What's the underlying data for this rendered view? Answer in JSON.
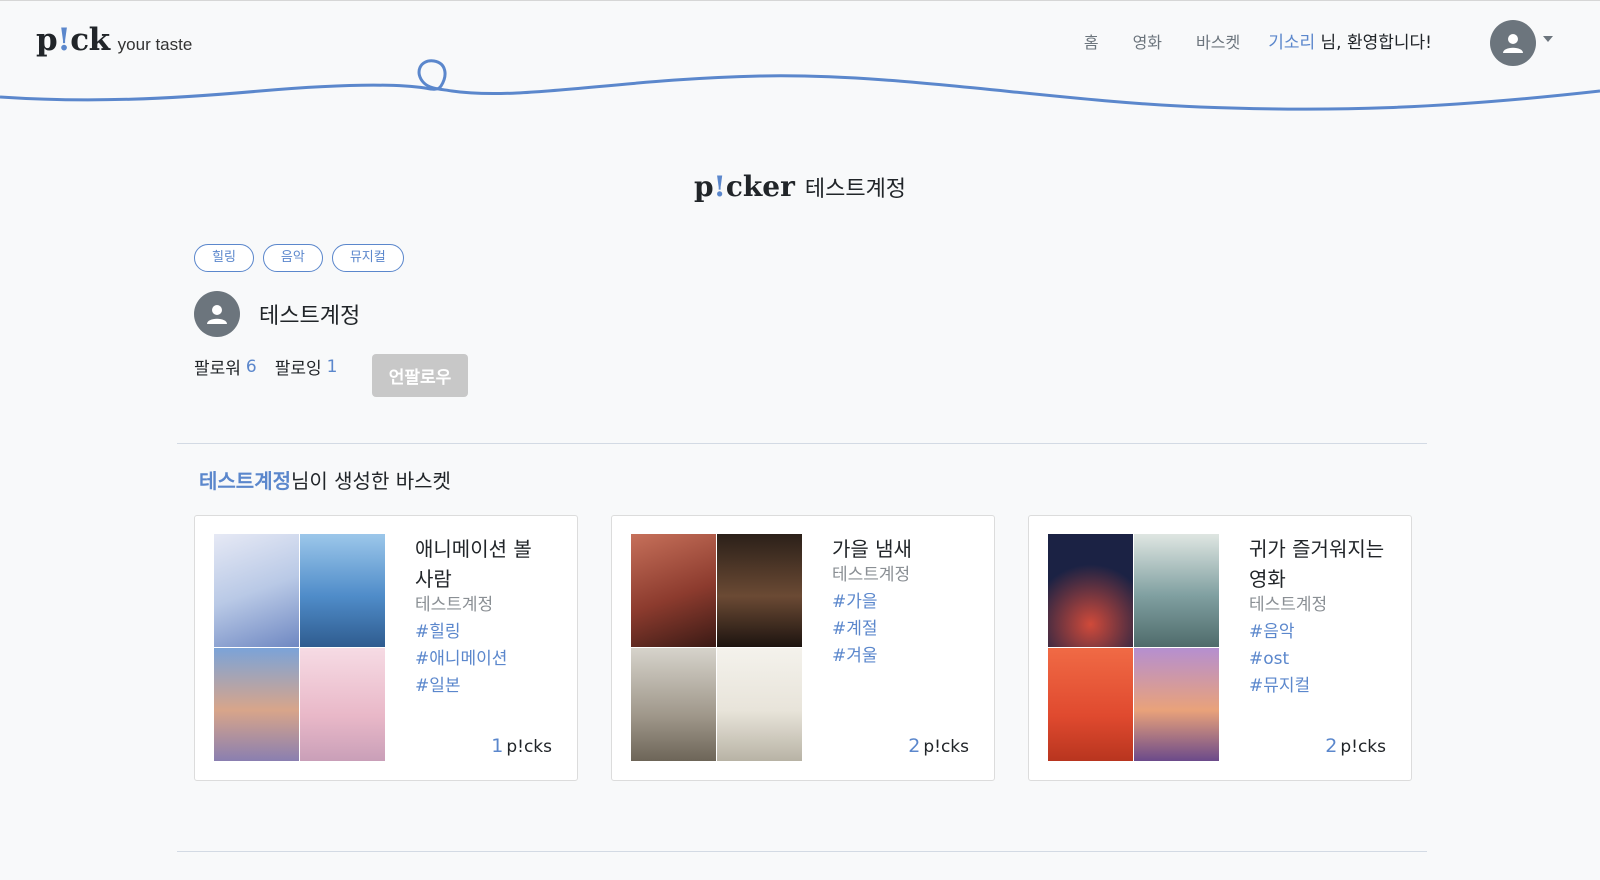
{
  "header": {
    "logo": {
      "p": "p",
      "bang": "!",
      "ck": "ck",
      "tagline": "your taste"
    },
    "nav": [
      {
        "label": "홈"
      },
      {
        "label": "영화"
      },
      {
        "label": "바스켓"
      }
    ],
    "welcome": {
      "username": "기소리",
      "suffix": " 님, 환영합니다!"
    }
  },
  "page_title": {
    "p": "p",
    "bang": "!",
    "rest": "cker",
    "name": "테스트계정"
  },
  "profile": {
    "tags": [
      "힐링",
      "음악",
      "뮤지컬"
    ],
    "name": "테스트계정",
    "followers_label": "팔로워",
    "followers": "6",
    "following_label": "팔로잉",
    "following": "1",
    "unfollow_label": "언팔로우"
  },
  "baskets_section": {
    "owner": "테스트계정",
    "suffix": "님이 생성한 바스켓"
  },
  "baskets": [
    {
      "title": "애니메이션 볼 사람",
      "author": "테스트계정",
      "tags": [
        "#힐링",
        "#애니메이션",
        "#일본"
      ],
      "count": "1",
      "count_unit": "p!cks",
      "posters": [
        "#b9c9e6",
        "#4f8cc9",
        "#8a7fb0",
        "#e9b8c8"
      ]
    },
    {
      "title": "가을 냄새",
      "author": "테스트계정",
      "tags": [
        "#가을",
        "#계절",
        "#겨울"
      ],
      "count": "2",
      "count_unit": "p!cks",
      "posters": [
        "#8c3b2e",
        "#4a3626",
        "#b9b4a8",
        "#e8e4da"
      ]
    },
    {
      "title": "귀가 즐거워지는 영화",
      "author": "테스트계정",
      "tags": [
        "#음악",
        "#ost",
        "#뮤지컬"
      ],
      "count": "2",
      "count_unit": "p!cks",
      "posters": [
        "#1b2244",
        "#7f9fa0",
        "#e04a2f",
        "#8f6fa8"
      ]
    }
  ]
}
